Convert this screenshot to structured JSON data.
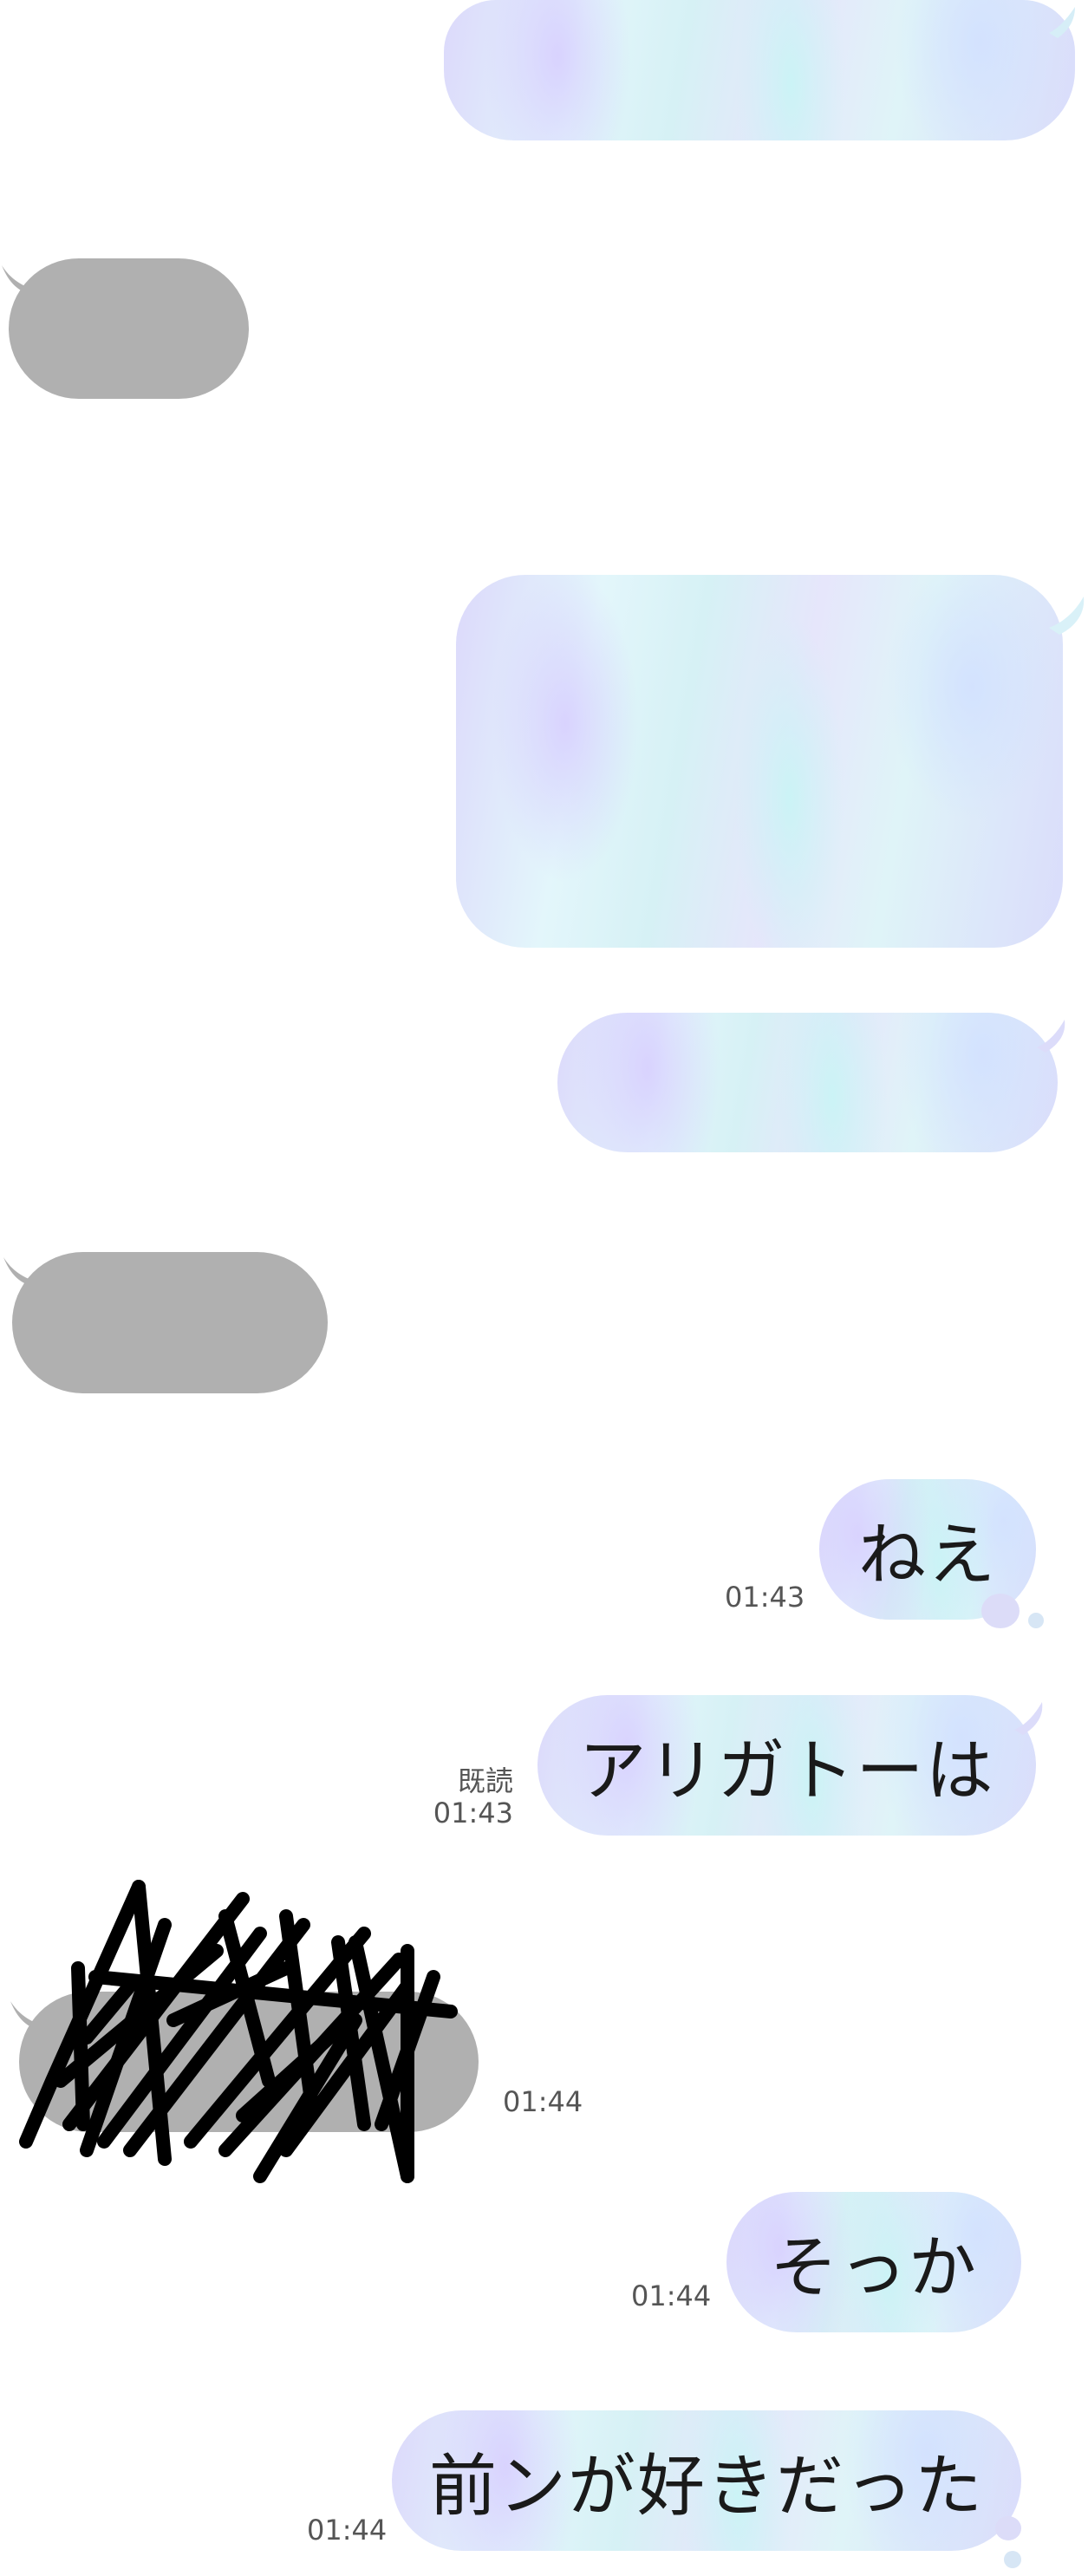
{
  "chat": {
    "messages": [
      {
        "id": "m1",
        "side": "right",
        "style": "holographic",
        "text": ""
      },
      {
        "id": "m2",
        "side": "left",
        "style": "gray",
        "text": ""
      },
      {
        "id": "m3",
        "side": "right",
        "style": "holographic",
        "text": ""
      },
      {
        "id": "m4",
        "side": "right",
        "style": "holographic",
        "text": ""
      },
      {
        "id": "m5",
        "side": "left",
        "style": "gray",
        "text": ""
      },
      {
        "id": "m6",
        "side": "right",
        "style": "holographic",
        "text": "ねえ",
        "time": "01:43"
      },
      {
        "id": "m7",
        "side": "right",
        "style": "holographic",
        "text": "アリガトーは",
        "read": "既読",
        "time": "01:43"
      },
      {
        "id": "m8",
        "side": "left",
        "style": "gray",
        "text": "",
        "time": "01:44",
        "scribbled": true
      },
      {
        "id": "m9",
        "side": "right",
        "style": "holographic",
        "text": "そっか",
        "time": "01:44"
      },
      {
        "id": "m10",
        "side": "right",
        "style": "holographic",
        "text": "前ンが好きだった",
        "time": "01:44"
      }
    ]
  },
  "colors": {
    "gray_bubble": "#b0b0b0",
    "holo_tint_violet": "#dcd9fb",
    "holo_tint_cyan": "#d6f1f5",
    "timestamp": "#555555",
    "scribble": "#000000"
  }
}
